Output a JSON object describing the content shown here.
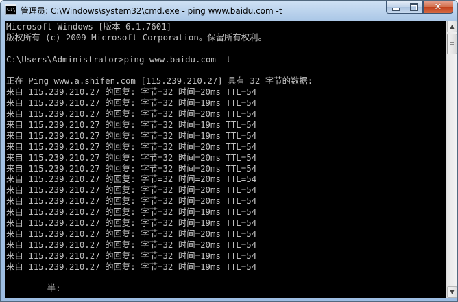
{
  "window": {
    "title": "管理员: C:\\Windows\\system32\\cmd.exe - ping  www.baidu.com -t",
    "icon_text": "C:\\",
    "controls": {
      "minimize": "minimize-icon",
      "maximize": "maximize-icon",
      "close": "close-icon",
      "close_glyph": "✕"
    }
  },
  "console": {
    "colors": {
      "background": "#000000",
      "text": "#c0c0c0"
    },
    "lines": [
      "Microsoft Windows [版本 6.1.7601]",
      "版权所有 (c) 2009 Microsoft Corporation。保留所有权利。",
      "",
      "C:\\Users\\Administrator>ping www.baidu.com -t",
      "",
      "正在 Ping www.a.shifen.com [115.239.210.27] 具有 32 字节的数据:",
      "来自 115.239.210.27 的回复: 字节=32 时间=20ms TTL=54",
      "来自 115.239.210.27 的回复: 字节=32 时间=19ms TTL=54",
      "来自 115.239.210.27 的回复: 字节=32 时间=20ms TTL=54",
      "来自 115.239.210.27 的回复: 字节=32 时间=19ms TTL=54",
      "来自 115.239.210.27 的回复: 字节=32 时间=19ms TTL=54",
      "来自 115.239.210.27 的回复: 字节=32 时间=20ms TTL=54",
      "来自 115.239.210.27 的回复: 字节=32 时间=20ms TTL=54",
      "来自 115.239.210.27 的回复: 字节=32 时间=20ms TTL=54",
      "来自 115.239.210.27 的回复: 字节=32 时间=20ms TTL=54",
      "来自 115.239.210.27 的回复: 字节=32 时间=20ms TTL=54",
      "来自 115.239.210.27 的回复: 字节=32 时间=20ms TTL=54",
      "来自 115.239.210.27 的回复: 字节=32 时间=19ms TTL=54",
      "来自 115.239.210.27 的回复: 字节=32 时间=19ms TTL=54",
      "来自 115.239.210.27 的回复: 字节=32 时间=20ms TTL=54",
      "来自 115.239.210.27 的回复: 字节=32 时间=20ms TTL=54",
      "来自 115.239.210.27 的回复: 字节=32 时间=19ms TTL=54",
      "来自 115.239.210.27 的回复: 字节=32 时间=19ms TTL=54",
      "",
      "        半:"
    ]
  },
  "scrollbar": {
    "up_arrow": "▲",
    "down_arrow": "▼"
  }
}
